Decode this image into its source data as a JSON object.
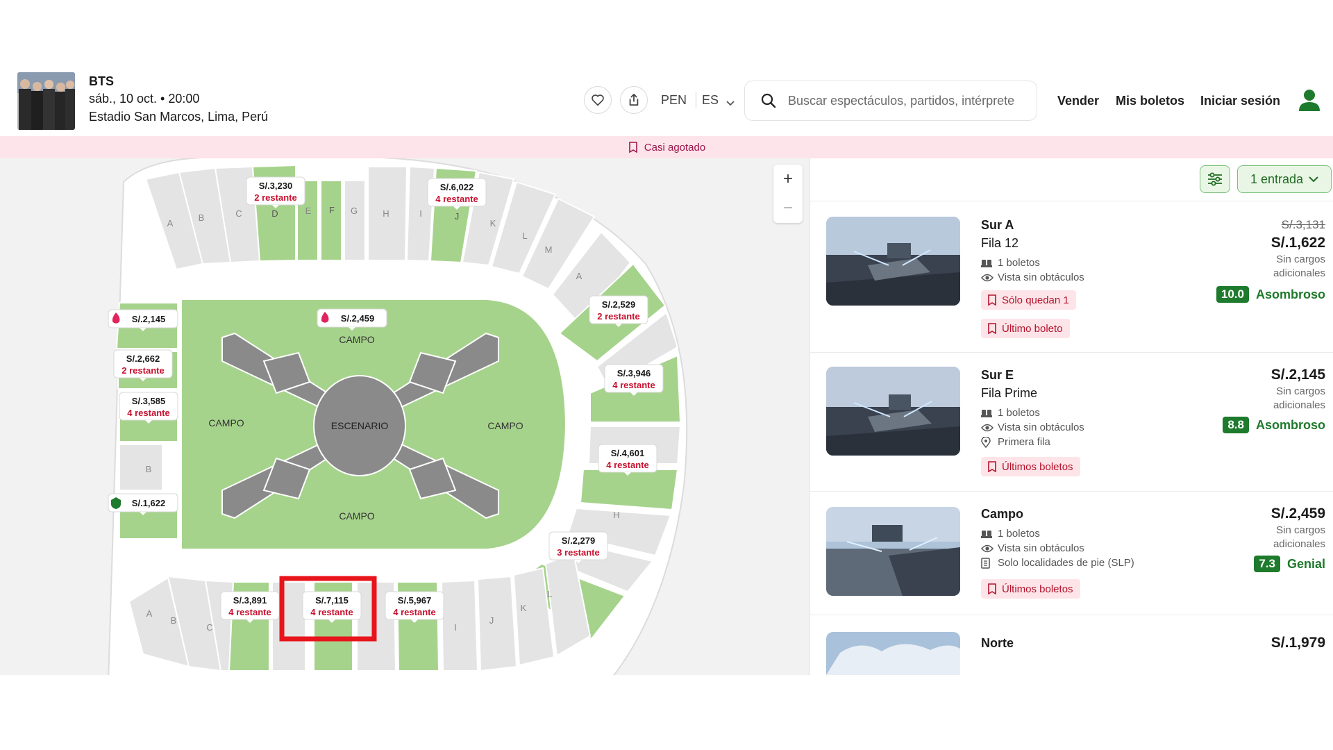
{
  "event": {
    "title": "BTS",
    "date": "sáb., 10 oct. • 20:00",
    "venue": "Estadio San Marcos, Lima, Perú"
  },
  "header": {
    "favorite_icon": "heart-icon",
    "share_icon": "share-icon",
    "currency": "PEN",
    "language": "ES",
    "search_placeholder": "Buscar espectáculos, partidos, intérprete",
    "nav": {
      "sell": "Vender",
      "my_tickets": "Mis boletos",
      "login": "Iniciar sesión"
    }
  },
  "banner": {
    "text": "Casi agotado"
  },
  "map": {
    "zoom_in": "+",
    "zoom_out": "−",
    "stage_label": "ESCENARIO",
    "field_label": "CAMPO",
    "section_letters": [
      "A",
      "B",
      "C",
      "D",
      "E",
      "F",
      "G",
      "H",
      "I",
      "J",
      "K",
      "L",
      "M"
    ],
    "price_tags": [
      {
        "id": "top-d",
        "price": "S/.3,230",
        "remaining": "2 restante",
        "section": "D"
      },
      {
        "id": "top-j",
        "price": "S/.6,022",
        "remaining": "4 restante",
        "section": "J"
      },
      {
        "id": "right-c",
        "price": "S/.2,529",
        "remaining": "2 restante",
        "section": "C"
      },
      {
        "id": "right-e",
        "price": "S/.3,946",
        "remaining": "4 restante",
        "section": "E"
      },
      {
        "id": "right-g",
        "price": "S/.4,601",
        "remaining": "4 restante",
        "section": "G"
      },
      {
        "id": "right-j",
        "price": "S/.2,279",
        "remaining": "3 restante",
        "section": "J"
      },
      {
        "id": "left-e",
        "price": "S/.2,145",
        "remaining": "",
        "section": "E",
        "hot": true
      },
      {
        "id": "left-2",
        "price": "S/.2,662",
        "remaining": "2 restante",
        "section": "D"
      },
      {
        "id": "left-3",
        "price": "S/.3,585",
        "remaining": "4 restante",
        "section": "C"
      },
      {
        "id": "left-a",
        "price": "S/.1,622",
        "remaining": "",
        "section": "A",
        "deal": true
      },
      {
        "id": "campo",
        "price": "S/.2,459",
        "remaining": "",
        "section": "CAMPO",
        "hot": true
      },
      {
        "id": "bottom-d",
        "price": "S/.3,891",
        "remaining": "4 restante",
        "section": "D"
      },
      {
        "id": "bottom-f",
        "price": "S/.7,115",
        "remaining": "4 restante",
        "section": "F",
        "highlighted": true
      },
      {
        "id": "bottom-h",
        "price": "S/.5,967",
        "remaining": "4 restante",
        "section": "H"
      }
    ]
  },
  "list": {
    "filter_icon": "sliders-icon",
    "quantity": "1 entrada",
    "listings": [
      {
        "name": "Sur A",
        "row": "Fila 12",
        "tickets": "1 boletos",
        "view": "Vista sin obtáculos",
        "extra": "",
        "tags": [
          "Sólo quedan 1",
          "Último boleto"
        ],
        "old_price": "S/.3,131",
        "price": "S/.1,622",
        "note_line1": "Sin cargos",
        "note_line2": "adicionales",
        "score": "10.0",
        "rating": "Asombroso"
      },
      {
        "name": "Sur E",
        "row": "Fila Prime",
        "tickets": "1 boletos",
        "view": "Vista sin obtáculos",
        "extra": "Primera fila",
        "tags": [
          "Últimos boletos"
        ],
        "old_price": "",
        "price": "S/.2,145",
        "note_line1": "Sin cargos",
        "note_line2": "adicionales",
        "score": "8.8",
        "rating": "Asombroso"
      },
      {
        "name": "Campo",
        "row": "",
        "tickets": "1 boletos",
        "view": "Vista sin obtáculos",
        "extra": "Solo localidades de pie (SLP)",
        "tags": [
          "Últimos boletos"
        ],
        "old_price": "",
        "price": "S/.2,459",
        "note_line1": "Sin cargos",
        "note_line2": "adicionales",
        "score": "7.3",
        "rating": "Genial"
      },
      {
        "name": "Norte",
        "price": "S/.1,979"
      }
    ]
  },
  "colors": {
    "green": "#a6d38c",
    "accent": "#1e7a2c",
    "red": "#c8102e",
    "banner": "#fde3ea"
  }
}
